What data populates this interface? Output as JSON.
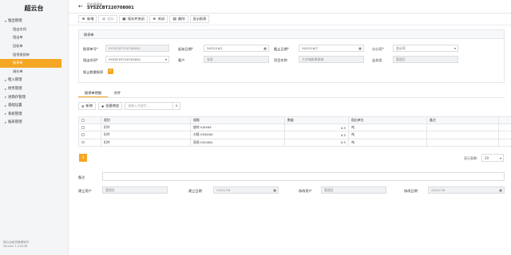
{
  "app": {
    "title": "超云台",
    "footer_line1": "超云台租赁管理软件",
    "footer_line2": "Version 1.0.6236"
  },
  "sidebar": {
    "groups": [
      {
        "label": "租出管理",
        "expanded": true,
        "items": [
          {
            "label": "租出合同"
          },
          {
            "label": "租出单"
          },
          {
            "label": "回收单"
          },
          {
            "label": "租赁报损单"
          },
          {
            "label": "报停单",
            "active": true
          },
          {
            "label": "调价单"
          }
        ]
      },
      {
        "label": "租入管理",
        "expanded": false
      },
      {
        "label": "财务管理",
        "expanded": false
      },
      {
        "label": "进销存管理",
        "expanded": false
      },
      {
        "label": "基础设置",
        "expanded": false
      },
      {
        "label": "系统管理",
        "expanded": false
      },
      {
        "label": "报表管理",
        "expanded": false
      }
    ]
  },
  "header": {
    "subtitle": "租出报停单",
    "title": "SYSZCBT220708001"
  },
  "toolbar": {
    "new": "新增",
    "save": "保存",
    "save_close": "保存并关闭",
    "close": "关闭",
    "delete": "删除",
    "print": "显示报表"
  },
  "form": {
    "section_title": "报停单",
    "doc_no": {
      "label": "报停单号*",
      "value": "SYSZCBT220708001"
    },
    "start_date": {
      "label": "起始日期*",
      "value": "2022/10/1"
    },
    "end_date": {
      "label": "截止日期*",
      "value": "2022/10/7"
    },
    "branch": {
      "label": "分公司*",
      "value": "总公司"
    },
    "contract": {
      "label": "租出合同*",
      "value": "SYSZCHT220705001"
    },
    "customer": {
      "label": "客户",
      "value": "张思"
    },
    "project": {
      "label": "项目名称",
      "value": "大学城新建商城"
    },
    "salesman": {
      "label": "业务员",
      "value": "管理员"
    },
    "include_weekend": {
      "label": "报止数量报停",
      "checked": true
    }
  },
  "tabs": [
    {
      "label": "报停单明细",
      "active": true
    },
    {
      "label": "附件",
      "active": false
    }
  ],
  "detail": {
    "add": "新增",
    "batch_add": "批量增加",
    "search_placeholder": "请输入关键字...",
    "columns": [
      "类别",
      "规格",
      "数量",
      "租出单位",
      "备注"
    ],
    "rows": [
      {
        "category": "扣件",
        "spec": "旋转 KJ048A",
        "qty": "0.5",
        "unit": "吨",
        "note": ""
      },
      {
        "category": "扣件",
        "spec": "对接 KD048A",
        "qty": "0.5",
        "unit": "吨",
        "note": ""
      },
      {
        "category": "扣件",
        "spec": "直角 KZ048A",
        "qty": "0.5",
        "unit": "吨",
        "note": ""
      }
    ],
    "page": "1",
    "page_size_label": "显示条数:",
    "page_size": "20"
  },
  "footer": {
    "remark_label": "备注",
    "creator_label": "建立用户",
    "creator": "管理员",
    "created_label": "建立日期",
    "created": "2022/7/8",
    "modifier_label": "修改用户",
    "modifier": "管理员",
    "modified_label": "修改日期",
    "modified": "2022/7/8"
  }
}
